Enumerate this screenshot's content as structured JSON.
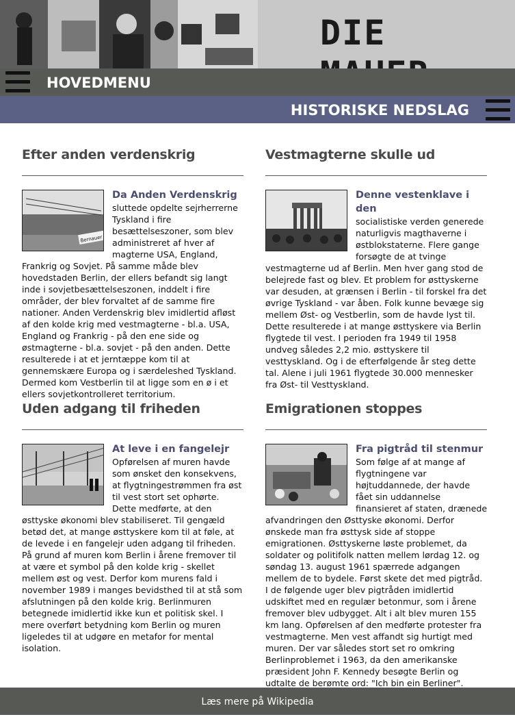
{
  "banner": {
    "logo_text": "DIE MAUER",
    "photo": "black-and-white collage of Berlin Wall scenes"
  },
  "nav": {
    "main_menu_label": "HOVEDMENU",
    "main_menu_icon": "hamburger-icon",
    "section_label": "HISTORISKE NEDSLAG",
    "section_menu_icon": "hamburger-icon"
  },
  "sections": [
    {
      "heading": "Efter anden verdenskrig",
      "lead": "Da Anden Verdenskrig",
      "body": "sluttede opdelte sejrherrerne Tyskland i fire besættelseszoner, som blev administreret af hver af magterne USA, England, Frankrig og Sovjet. På samme måde blev hovedstaden Berlin, der ellers befandt sig langt inde i sovjetbesættelseszonen, inddelt i fire områder, der blev forvaltet af de samme fire nationer. Anden Verdenskrig blev imidlertid afløst af den kolde krig med vestmagterne - bl.a. USA, England og Frankrig - på den ene side og østmagterne - bl.a. sovjet - på den anden. Dette resulterede i at et jerntæppe kom til at gennemskære Europa og i særdeleshed Tyskland. Dermed kom Vestberlin til at ligge som en ø i et ellers sovjetkontrolleret territorium.",
      "image_sign": "Bernauer Str."
    },
    {
      "heading": "Vestmagterne skulle ud",
      "lead": "Denne vestenklave i den",
      "body": "socialistiske verden generede naturligvis magthaverne i østblokstaterne. Flere gange forsøgte de at tvinge vestmagterne ud af Berlin. Men hver gang stod de belejrede fast og blev. Et problem for østtyskerne var desuden, at grænsen i Berlin - til forskel fra det øvrige Tyskland - var åben. Folk kunne bevæge sig mellem Øst- og Vestberlin, som de havde lyst til. Dette resulterede i at mange østtyskere via Berlin flygtede til vest. I perioden fra 1949 til 1958 undveg således 2,2 mio. østtyskere til vesttyskland. Og i de efterfølgende år steg dette tal. Alene i juli 1961 flygtede 30.000 mennesker fra Øst- til Vesttyskland."
    },
    {
      "heading": "Uden adgang til friheden",
      "lead": "At leve i en fangelejr",
      "body": "Opførelsen af muren havde som ønsket den konsekvens, at flygtningestrømmen fra øst til vest stort set ophørte. Dette medførte, at den østtyske økonomi blev stabiliseret. Til gengæld betød det, at mange østtyskere kom til at føle, at de levede i en fangelejr uden adgang til friheden. På grund af muren kom Berlin i årene fremover til at være et symbol på den kolde krig - skellet mellem øst og vest. Derfor kom murens fald i november 1989 i manges bevidsthed til at stå som afslutningen på den kolde krig. Berlinmuren betegnede imidlertid ikke kun et politisk skel. I mere overført betydning kom Berlin og muren ligeledes til at udgøre en metafor for mental isolation."
    },
    {
      "heading": "Emigrationen stoppes",
      "lead": "Fra pigtråd til stenmur",
      "body": "Som følge af at mange af flygtningene var højtuddannede, der havde fået sin uddannelse finansieret af staten, drænede afvandringen den Østtyske økonomi. Derfor ønskede man fra østtysk side af stoppe emigrationen. Østtyskerne løste problemet, da soldater og politifolk natten mellem lørdag 12. og søndag 13. august 1961 spærrede adgangen mellem de to bydele. Først skete det med pigtråd. I de følgende uger blev pigtråden imidlertid udskiftet med en regulær betonmur, som i årene fremover blev udbygget. Alt i alt blev muren 155 km lang. Opførelsen af den medførte protester fra vestmagterne. Men vest affandt sig hurtigt med muren. Der var således stort set ro omkring Berlinproblemet i 1963, da den amerikanske præsident John F. Kennedy besøgte Berlin og udtalte de berømte ord: \"Ich bin ein Berliner\"."
    }
  ],
  "footer": {
    "link_label": "Læs mere på Wikipedia"
  }
}
